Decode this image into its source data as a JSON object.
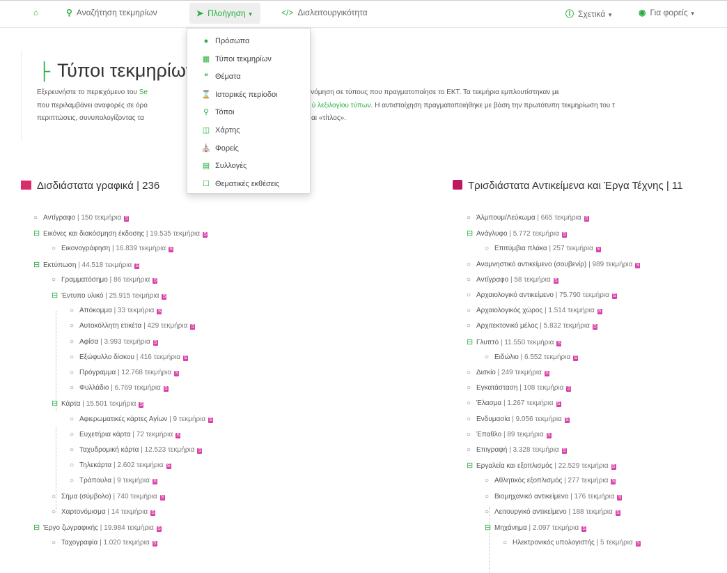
{
  "nav": {
    "home_icon": "home-icon",
    "search": "Αναζήτηση τεκμηρίων",
    "browse": "Πλοήγηση",
    "interop": "Διαλειτουργικότητα",
    "about": "Σχετικά",
    "for_orgs": "Για φορείς"
  },
  "dropdown": {
    "items": [
      {
        "label": "Πρόσωπα",
        "icon": "person-icon"
      },
      {
        "label": "Τύποι τεκμηρίων",
        "icon": "sitemap-icon"
      },
      {
        "label": "Θέματα",
        "icon": "quote-icon"
      },
      {
        "label": "Ιστορικές περίοδοι",
        "icon": "hourglass-icon"
      },
      {
        "label": "Τόποι",
        "icon": "map-marker-icon"
      },
      {
        "label": "Χάρτης",
        "icon": "map-icon"
      },
      {
        "label": "Φορείς",
        "icon": "institution-icon"
      },
      {
        "label": "Συλλογές",
        "icon": "database-icon"
      },
      {
        "label": "Θεματικές εκθέσεις",
        "icon": "bookmark-icon"
      }
    ]
  },
  "page": {
    "title": "Τύποι τεκμηρίων",
    "intro_1a": "Εξερευνήστε το περιεχόμενο του ",
    "intro_1b": "Se",
    "intro_1c": "ην ιεραρχική ταξινόμηση σε τύπους που πραγματοποίησε το ΕΚΤ. Τα τεκμήρια εμπλουτίστηκαν με",
    "intro_2a": "που περιλαμβάνει αναφορές σε όρο",
    "intro_2b": "ύ λεξιλογίου τύπων",
    "intro_2c": ". Η αντιστοίχηση πραγματοποιήθηκε με βάση την πρωτότυπη τεκμηρίωση του τ",
    "intro_3a": "περιπτώσεις, συνυπολογίζοντας τα",
    "intro_3b": "αι «τίτλος»."
  },
  "sections": {
    "left_title": "Δισδιάστατα γραφικά",
    "left_count": "| 236",
    "right_title": "Τρισδιάστατα Αντικείμενα και Έργα Τέχνης",
    "right_count": "| 11"
  },
  "left_tree": [
    {
      "label": "Αντίγραφο",
      "count": "| 150 τεκμήρια",
      "exp": false,
      "lvl": 0
    },
    {
      "label": "Εικόνες και διακόσμηση έκδοσης",
      "count": "| 19.535 τεκμήρια",
      "exp": true,
      "lvl": 0
    },
    {
      "label": "Εικονογράφηση",
      "count": "| 16.839 τεκμήρια",
      "exp": false,
      "lvl": 1
    },
    {
      "label": "Εκτύπωση",
      "count": "| 44.518 τεκμήρια",
      "exp": true,
      "lvl": 0
    },
    {
      "label": "Γραμματόσημο",
      "count": "| 86 τεκμήρια",
      "exp": false,
      "lvl": 1
    },
    {
      "label": "Έντυπο υλικό",
      "count": "| 25.915 τεκμήρια",
      "exp": true,
      "lvl": 1
    },
    {
      "label": "Απόκομμα",
      "count": "| 33 τεκμήρια",
      "exp": false,
      "lvl": 2
    },
    {
      "label": "Αυτοκόλλητη ετικέτα",
      "count": "| 429 τεκμήρια",
      "exp": false,
      "lvl": 2
    },
    {
      "label": "Αφίσα",
      "count": "| 3.993 τεκμήρια",
      "exp": false,
      "lvl": 2
    },
    {
      "label": "Εξώφυλλο δίσκου",
      "count": "| 416 τεκμήρια",
      "exp": false,
      "lvl": 2
    },
    {
      "label": "Πρόγραμμα",
      "count": "| 12.768 τεκμήρια",
      "exp": false,
      "lvl": 2
    },
    {
      "label": "Φυλλάδιο",
      "count": "| 6.769 τεκμήρια",
      "exp": false,
      "lvl": 2
    },
    {
      "label": "Κάρτα",
      "count": "| 15.501 τεκμήρια",
      "exp": true,
      "lvl": 1
    },
    {
      "label": "Αφιερωματικές κάρτες Αγίων",
      "count": "| 9 τεκμήρια",
      "exp": false,
      "lvl": 2
    },
    {
      "label": "Ευχετήρια κάρτα",
      "count": "| 72 τεκμήρια",
      "exp": false,
      "lvl": 2
    },
    {
      "label": "Ταχυδρομική κάρτα",
      "count": "| 12.523 τεκμήρια",
      "exp": false,
      "lvl": 2
    },
    {
      "label": "Τηλεκάρτα",
      "count": "| 2.602 τεκμήρια",
      "exp": false,
      "lvl": 2
    },
    {
      "label": "Τράπουλα",
      "count": "| 9 τεκμήρια",
      "exp": false,
      "lvl": 2
    },
    {
      "label": "Σήμα (σύμβολο)",
      "count": "| 740 τεκμήρια",
      "exp": false,
      "lvl": 1
    },
    {
      "label": "Χαρτονόμισμα",
      "count": "| 14 τεκμήρια",
      "exp": false,
      "lvl": 1
    },
    {
      "label": "Έργο ζωγραφικής",
      "count": "| 19.984 τεκμήρια",
      "exp": true,
      "lvl": 0
    },
    {
      "label": "Ταχογραφία",
      "count": "| 1.020 τεκμήρια",
      "exp": false,
      "lvl": 1
    }
  ],
  "right_tree": [
    {
      "label": "Άλμπουμ/Λεύκωμα",
      "count": "| 665 τεκμήρια",
      "exp": false,
      "lvl": 0
    },
    {
      "label": "Ανάγλυφο",
      "count": "| 5.772 τεκμήρια",
      "exp": true,
      "lvl": 0
    },
    {
      "label": "Επιτύμβια πλάκα",
      "count": "| 257 τεκμήρια",
      "exp": false,
      "lvl": 1
    },
    {
      "label": "Αναμνηστικό αντικείμενο (σουβενίρ)",
      "count": "| 989 τεκμήρια",
      "exp": false,
      "lvl": 0
    },
    {
      "label": "Αντίγραφο",
      "count": "| 58 τεκμήρια",
      "exp": false,
      "lvl": 0
    },
    {
      "label": "Αρχαιολογικό αντικείμενο",
      "count": "| 75.790 τεκμήρια",
      "exp": false,
      "lvl": 0
    },
    {
      "label": "Αρχαιολογικός χώρος",
      "count": "| 1.514 τεκμήρια",
      "exp": false,
      "lvl": 0
    },
    {
      "label": "Αρχιτεκτονικό μέλος",
      "count": "| 5.832 τεκμήρια",
      "exp": false,
      "lvl": 0
    },
    {
      "label": "Γλυπτό",
      "count": "| 11.550 τεκμήρια",
      "exp": true,
      "lvl": 0
    },
    {
      "label": "Ειδώλιο",
      "count": "| 6.552 τεκμήρια",
      "exp": false,
      "lvl": 1
    },
    {
      "label": "Δισκίο",
      "count": "| 249 τεκμήρια",
      "exp": false,
      "lvl": 0
    },
    {
      "label": "Εγκατάσταση",
      "count": "| 108 τεκμήρια",
      "exp": false,
      "lvl": 0
    },
    {
      "label": "Έλασμα",
      "count": "| 1.267 τεκμήρια",
      "exp": false,
      "lvl": 0
    },
    {
      "label": "Ενδυμασία",
      "count": "| 9.056 τεκμήρια",
      "exp": false,
      "lvl": 0
    },
    {
      "label": "Έπαθλο",
      "count": "| 89 τεκμήρια",
      "exp": false,
      "lvl": 0
    },
    {
      "label": "Επιγραφή",
      "count": "| 3.328 τεκμήρια",
      "exp": false,
      "lvl": 0
    },
    {
      "label": "Εργαλεία και εξοπλισμός",
      "count": "| 22.529 τεκμήρια",
      "exp": true,
      "lvl": 0
    },
    {
      "label": "Αθλητικός εξοπλισμός",
      "count": "| 277 τεκμήρια",
      "exp": false,
      "lvl": 1
    },
    {
      "label": "Βιομηχανικό αντικείμενο",
      "count": "| 176 τεκμήρια",
      "exp": false,
      "lvl": 1
    },
    {
      "label": "Λειτουργικό αντικείμενο",
      "count": "| 188 τεκμήρια",
      "exp": false,
      "lvl": 1
    },
    {
      "label": "Μηχάνημα",
      "count": "| 2.097 τεκμήρια",
      "exp": true,
      "lvl": 1
    },
    {
      "label": "Ηλεκτρονικός υπολογιστής",
      "count": "| 5 τεκμήρια",
      "exp": false,
      "lvl": 2
    }
  ],
  "colors": {
    "accent": "#27ae3f",
    "source_icon": "#d940a8",
    "left_section_icon": "#d92d6b",
    "right_section_icon": "#c0165e"
  }
}
